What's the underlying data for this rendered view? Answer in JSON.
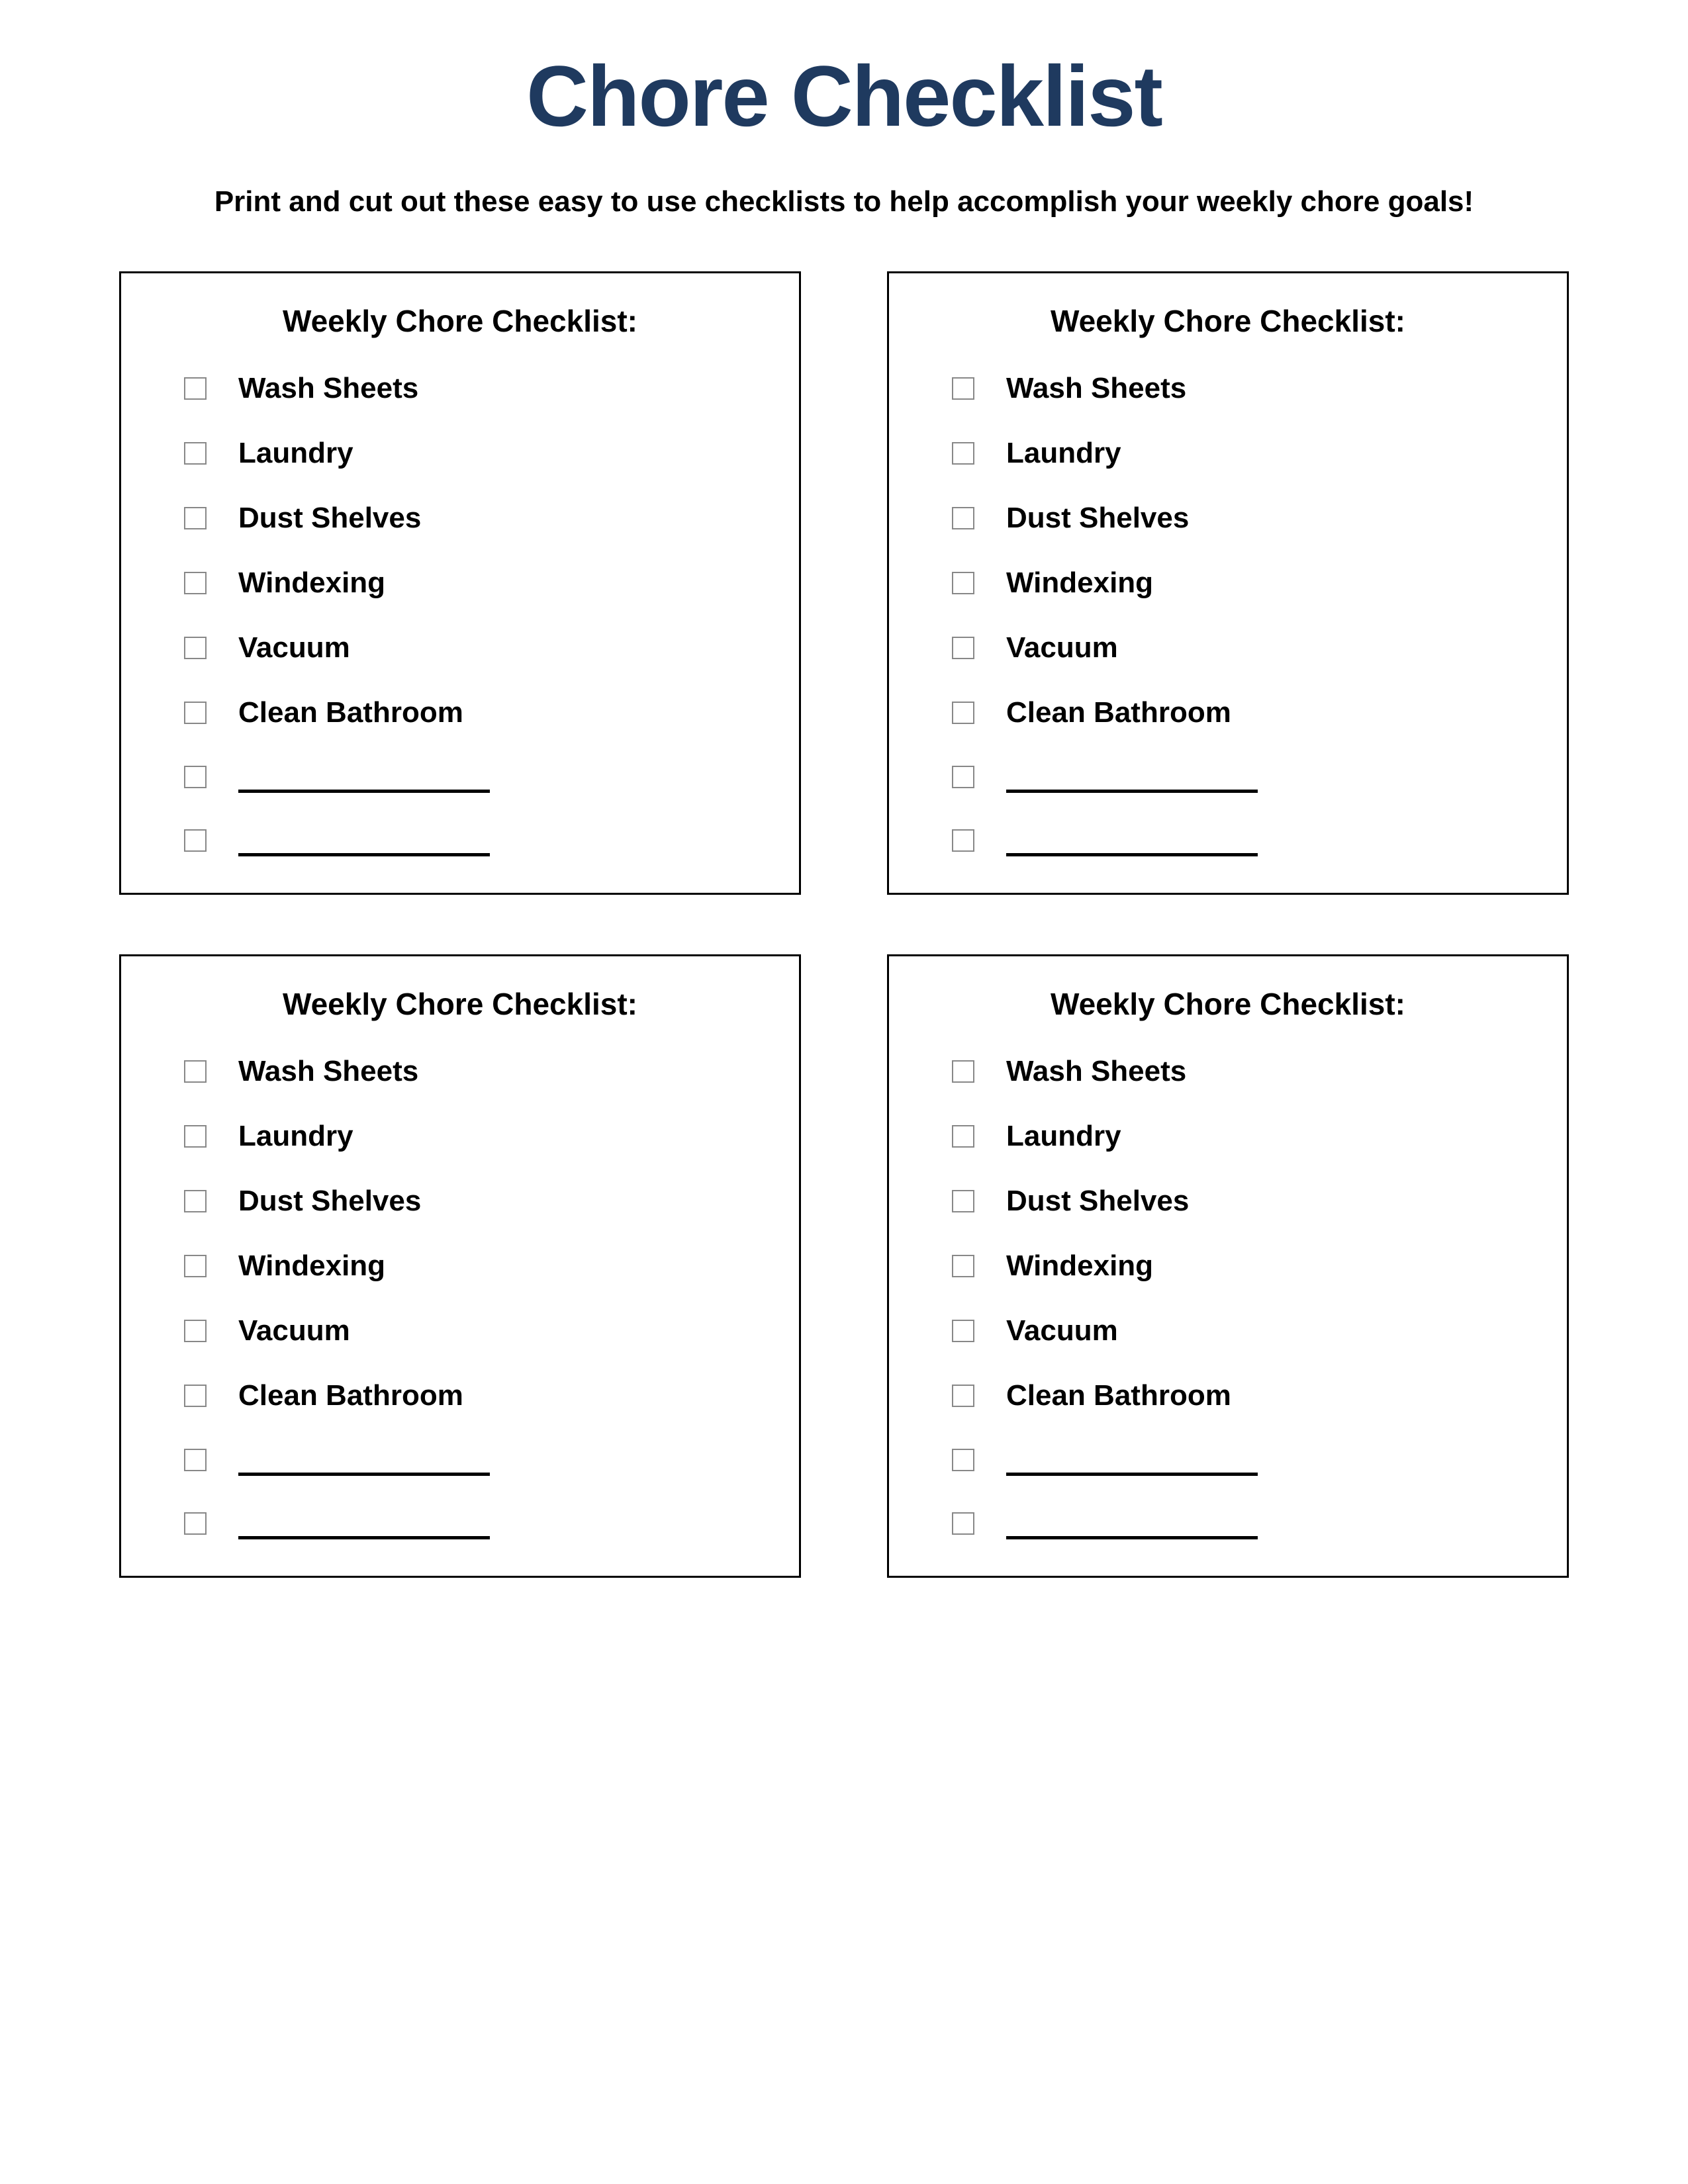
{
  "title": "Chore Checklist",
  "subtitle": "Print and cut out these easy to use checklists to help accomplish your weekly chore goals!",
  "card_title": "Weekly Chore Checklist:",
  "chores": [
    "Wash Sheets",
    "Laundry",
    "Dust Shelves",
    "Windexing",
    "Vacuum",
    "Clean Bathroom"
  ],
  "blank_count": 2,
  "card_count": 4
}
